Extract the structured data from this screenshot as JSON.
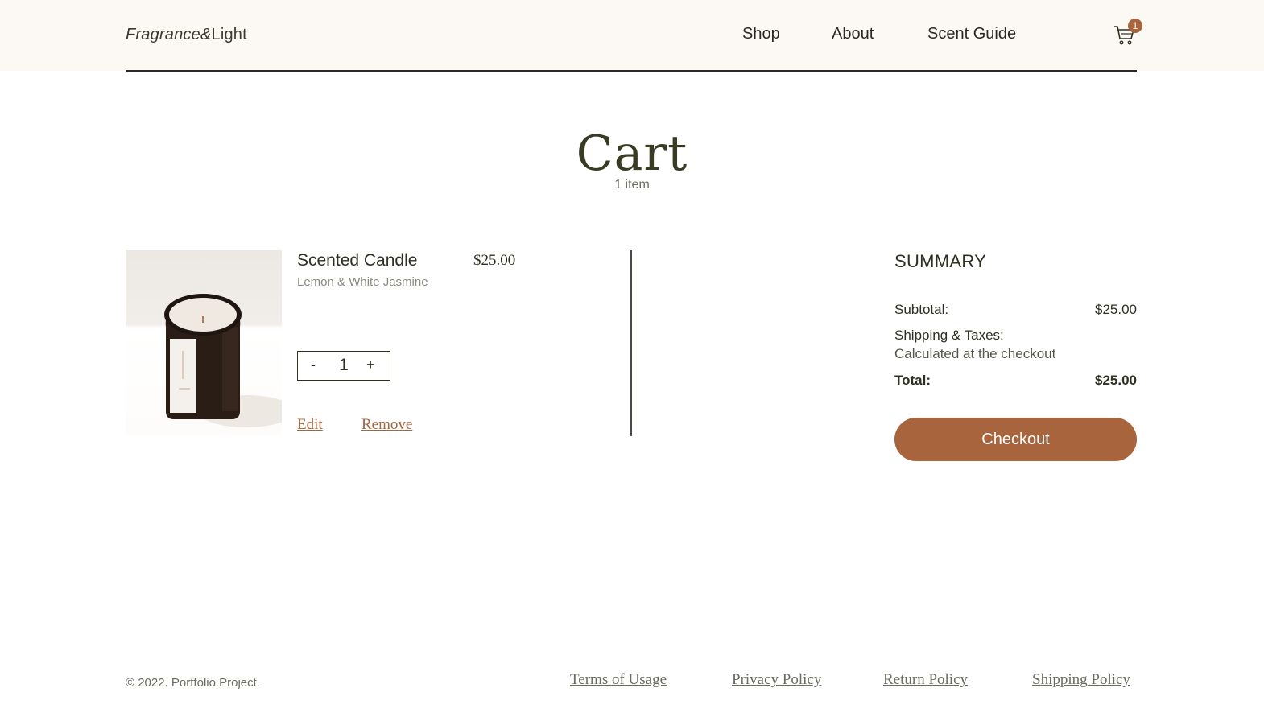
{
  "brand": {
    "part1": "Fragrance&",
    "part2": "Light"
  },
  "nav": {
    "shop": "Shop",
    "about": "About",
    "scent_guide": "Scent Guide"
  },
  "cart_badge": "1",
  "page": {
    "title": "Cart",
    "count": "1 item"
  },
  "item": {
    "name": "Scented Candle",
    "variant": "Lemon & White Jasmine",
    "price": "$25.00",
    "quantity": "1",
    "minus": "-",
    "plus": "+",
    "edit": "Edit",
    "remove": "Remove"
  },
  "summary": {
    "title": "SUMMARY",
    "subtotal_label": "Subtotal:",
    "subtotal_value": "$25.00",
    "shipping_label": "Shipping & Taxes:",
    "shipping_note": "Calculated at the checkout",
    "total_label": "Total:",
    "total_value": "$25.00",
    "checkout": "Checkout"
  },
  "footer": {
    "copyright": "© 2022. Portfolio Project.",
    "links": [
      "Terms of Usage",
      "Privacy Policy",
      "Return Policy",
      "Shipping Policy"
    ]
  },
  "colors": {
    "accent": "#a8643c",
    "header_bg": "#fcf8f3",
    "text": "#2f2f22"
  },
  "icons": {
    "cart": "shopping-cart-icon"
  }
}
